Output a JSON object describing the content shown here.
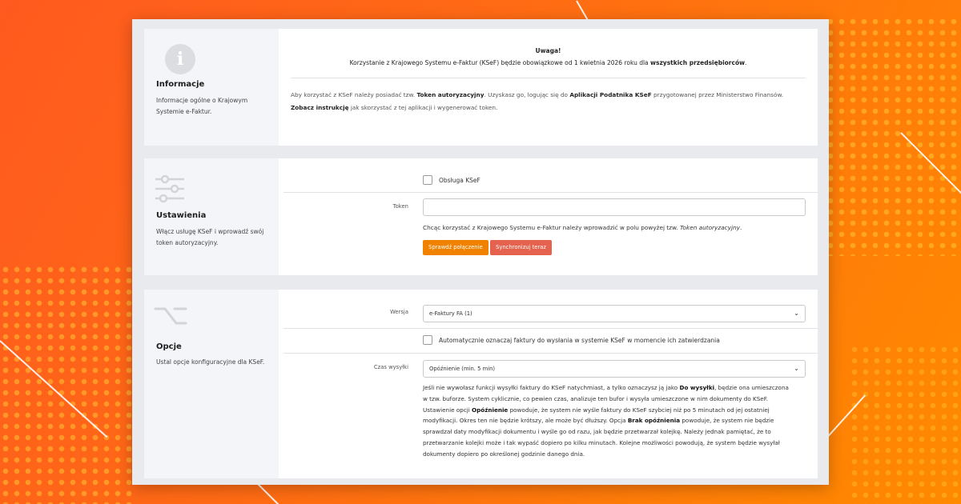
{
  "info": {
    "title": "Informacje",
    "desc": "Informacje ogólne o Krajowym Systemie e-Faktur.",
    "icon": "info-icon",
    "notice_title": "Uwaga!",
    "notice_text": "Korzystanie z Krajowego Systemu e-Faktur (KSeF) będzie obowiązkowe od 1 kwietnia 2026 roku dla",
    "notice_bold": "wszystkich przedsiębiorców",
    "notice_end": ".",
    "para_1": "Aby korzystać z KSeF należy posiadać tzw.",
    "para_token": "Token autoryzacyjny",
    "para_2": ". Uzyskasz go, logując się do",
    "para_app": "Aplikacji Podatnika KSeF",
    "para_3": "przygotowanej przez Ministerstwo Finansów.",
    "para_instr": "Zobacz instrukcję",
    "para_4": "jak skorzystać z tej aplikacji i wygenerować token."
  },
  "settings": {
    "title": "Ustawienia",
    "desc": "Włącz usługę KSeF i wprowadź swój token autoryzacyjny.",
    "icon": "sliders-icon",
    "ksef_checkbox_label": "Obsługa KSeF",
    "token_label": "Token",
    "token_value": "",
    "hint_text": "Chcąc korzystać z Krajowego Systemu e-Faktur należy wprowadzić w polu powyżej tzw.",
    "hint_italic": "Token autoryzacyjny",
    "hint_end": ".",
    "btn_check": "Sprawdź połączenie",
    "btn_sync": "Synchronizuj teraz"
  },
  "options": {
    "title": "Opcje",
    "desc": "Ustal opcje konfiguracyjne dla KSeF.",
    "icon": "switch-icon",
    "version_label": "Wersja",
    "version_value": "e-Faktury FA (1)",
    "auto_checkbox_label": "Automatycznie oznaczaj faktury do wysłania w systemie KSeF w momencie ich zatwierdzania",
    "time_label": "Czas wysyłki",
    "time_value": "Opóźnienie (min. 5 min)",
    "desc_1": "Jeśli nie wywołasz funkcji wysyłki faktury do KSeF natychmiast, a tylko oznaczysz ją jako",
    "desc_b1": "Do wysyłki",
    "desc_2": ", będzie ona umieszczona w tzw. buforze. System cyklicznie, co pewien czas, analizuje ten bufor i wysyła umieszczone w nim dokumenty do KSeF. Ustawienie opcji",
    "desc_b2": "Opóźnienie",
    "desc_3": "powoduje, że system nie wyśle faktury do KSeF szybciej niż po 5 minutach od jej ostatniej modyfikacji. Okres ten nie będzie krótszy, ale może być dłuższy. Opcja",
    "desc_b3": "Brak opóźnienia",
    "desc_4": "powoduje, że system nie będzie sprawdzał daty modyfikacji dokumentu i wyśle go od razu, jak będzie przetwarzał kolejkę. Należy jednak pamiętać, że to przetwarzanie kolejki może i tak wypaść dopiero po kilku minutach. Kolejne możliwości powodują, że system będzie wysyłał dokumenty dopiero po określonej godzinie danego dnia."
  },
  "colors": {
    "accent_orange": "#f08200",
    "accent_red": "#e4624e",
    "background": "#ff6a14"
  }
}
